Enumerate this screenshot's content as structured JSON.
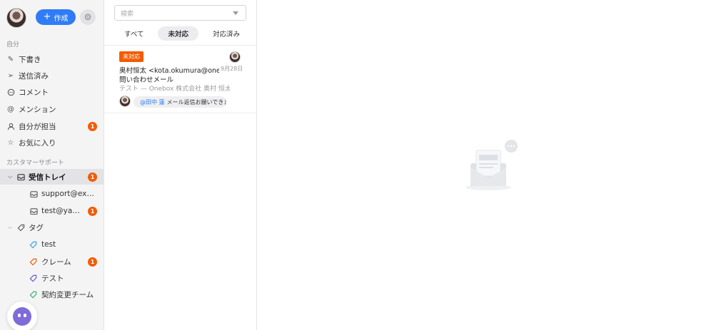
{
  "sidebar": {
    "compose_label": "作成",
    "section_self": "自分",
    "self_items": [
      {
        "label": "下書き",
        "icon": "pencil-icon"
      },
      {
        "label": "送信済み",
        "icon": "send-icon"
      },
      {
        "label": "コメント",
        "icon": "comment-icon"
      },
      {
        "label": "メンション",
        "icon": "at-icon"
      },
      {
        "label": "自分が担当",
        "icon": "person-icon",
        "badge": "1"
      },
      {
        "label": "お気に入り",
        "icon": "star-icon"
      }
    ],
    "section_support": "カスタマーサポート",
    "inbox": {
      "label": "受信トレイ",
      "badge": "1"
    },
    "inbox_children": [
      {
        "label": "support@example.com",
        "badge": ""
      },
      {
        "label": "test@yarukiswitch.jp",
        "badge": "1"
      }
    ],
    "tags": {
      "label": "タグ"
    },
    "tag_items": [
      {
        "label": "test",
        "color": "#3aa0e8",
        "badge": ""
      },
      {
        "label": "クレーム",
        "color": "#f25c05",
        "badge": "1"
      },
      {
        "label": "テスト",
        "color": "#6a5acd",
        "badge": ""
      },
      {
        "label": "契約変更チーム",
        "color": "#3cb371",
        "badge": ""
      }
    ]
  },
  "list": {
    "search_placeholder": "検索",
    "tabs": [
      "すべて",
      "未対応",
      "対応済み"
    ],
    "active_tab": "未対応",
    "items": [
      {
        "status": "未対応",
        "from": "奥村恒太 <kota.okumura@onebox.jp>",
        "date": "9月28日",
        "subject": "問い合わせメール",
        "preview": "テスト — Onebox 株式会社 奥村 恒太",
        "mention_user": "@田中 蓮",
        "mention_text": "メール返信お願いできますか？"
      }
    ]
  },
  "colors": {
    "accent": "#2f7cf6",
    "badge": "#f25c05"
  }
}
